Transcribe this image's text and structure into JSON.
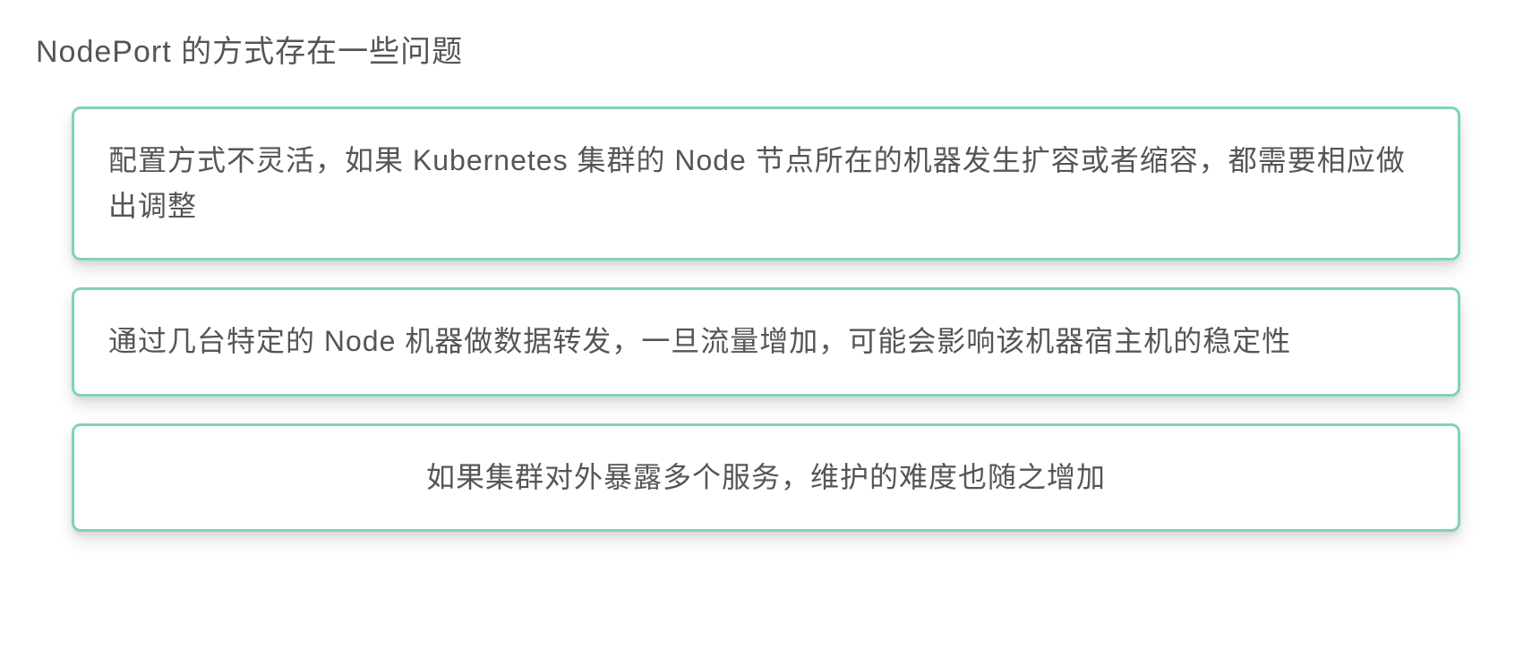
{
  "title": "NodePort 的方式存在一些问题",
  "cards": [
    {
      "text": "配置方式不灵活，如果 Kubernetes 集群的 Node 节点所在的机器发生扩容或者缩容，都需要相应做出调整",
      "centered": false
    },
    {
      "text": "通过几台特定的 Node 机器做数据转发，一旦流量增加，可能会影响该机器宿主机的稳定性",
      "centered": false
    },
    {
      "text": "如果集群对外暴露多个服务，维护的难度也随之增加",
      "centered": true
    }
  ],
  "colors": {
    "border": "#7ed4b5",
    "text": "#555555"
  }
}
